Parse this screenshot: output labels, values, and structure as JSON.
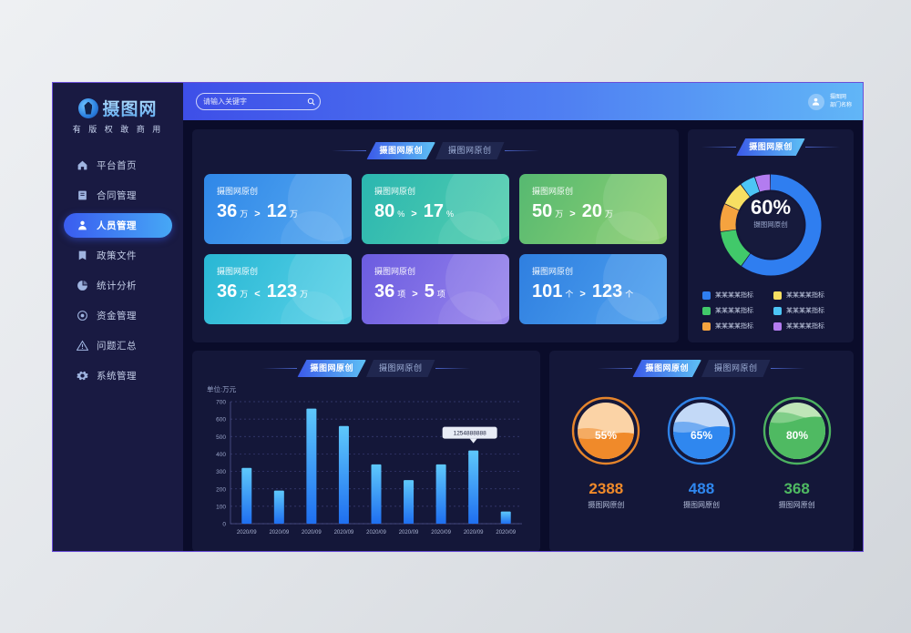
{
  "brand": {
    "name": "摄图网",
    "slogan": "有 版 权  敢 商 用",
    "logo_icon": "camera-shutter-icon"
  },
  "sidebar": {
    "items": [
      {
        "label": "平台首页",
        "icon": "home-icon",
        "active": false
      },
      {
        "label": "合同管理",
        "icon": "document-icon",
        "active": false
      },
      {
        "label": "人员管理",
        "icon": "user-icon",
        "active": true
      },
      {
        "label": "政策文件",
        "icon": "book-icon",
        "active": false
      },
      {
        "label": "统计分析",
        "icon": "pie-chart-icon",
        "active": false
      },
      {
        "label": "资金管理",
        "icon": "coin-icon",
        "active": false
      },
      {
        "label": "问题汇总",
        "icon": "warning-triangle-icon",
        "active": false
      },
      {
        "label": "系统管理",
        "icon": "gear-icon",
        "active": false
      }
    ]
  },
  "header": {
    "search_placeholder": "请输入关键字",
    "search_value": "",
    "search_icon": "search-icon",
    "avatar_icon": "user-avatar-icon",
    "user_name": "摄图网",
    "user_dept": "部门名称"
  },
  "kpi_panel": {
    "tabs": [
      {
        "label": "摄图网原创",
        "active": true
      },
      {
        "label": "摄图网原创",
        "active": false
      }
    ],
    "cards": [
      {
        "title": "摄图网原创",
        "v1": "36",
        "u1": "万",
        "cmp": ">",
        "v2": "12",
        "u2": "万",
        "color": "c1"
      },
      {
        "title": "摄图网原创",
        "v1": "80",
        "u1": "%",
        "cmp": ">",
        "v2": "17",
        "u2": "%",
        "color": "c2"
      },
      {
        "title": "摄图网原创",
        "v1": "50",
        "u1": "万",
        "cmp": ">",
        "v2": "20",
        "u2": "万",
        "color": "c3"
      },
      {
        "title": "摄图网原创",
        "v1": "36",
        "u1": "万",
        "cmp": "<",
        "v2": "123",
        "u2": "万",
        "color": "c4"
      },
      {
        "title": "摄图网原创",
        "v1": "36",
        "u1": "项",
        "cmp": ">",
        "v2": "5",
        "u2": "项",
        "color": "c5"
      },
      {
        "title": "摄图网原创",
        "v1": "101",
        "u1": "个",
        "cmp": ">",
        "v2": "123",
        "u2": "个",
        "color": "c6"
      }
    ]
  },
  "donut_panel": {
    "tabs": [
      {
        "label": "摄图网原创",
        "active": true
      }
    ],
    "center_value": "60%",
    "center_label": "摄图网原创",
    "legend": [
      {
        "label": "某某某某指标",
        "color": "#2f7ef0"
      },
      {
        "label": "某某某某指标",
        "color": "#f7df62"
      },
      {
        "label": "某某某某指标",
        "color": "#41c96a"
      },
      {
        "label": "某某某某指标",
        "color": "#4cc5f5"
      },
      {
        "label": "某某某某指标",
        "color": "#f5a33f"
      },
      {
        "label": "某某某某指标",
        "color": "#b37cf0"
      }
    ]
  },
  "bar_panel": {
    "tabs": [
      {
        "label": "摄图网原创",
        "active": true
      },
      {
        "label": "摄图网原创",
        "active": false
      }
    ],
    "axis_unit": "单位:万元",
    "tooltip": "1254888888"
  },
  "gauge_panel": {
    "tabs": [
      {
        "label": "摄图网原创",
        "active": true
      },
      {
        "label": "摄图网原创",
        "active": false
      }
    ],
    "gauges": [
      {
        "percent": "55%",
        "value": 55,
        "number": "2388",
        "label": "摄图网原创",
        "color": "#f08a2a",
        "light": "#fbd3a6",
        "ring": "#f08a2a"
      },
      {
        "percent": "65%",
        "value": 65,
        "number": "488",
        "label": "摄图网原创",
        "color": "#2f87ef",
        "light": "#c3d9f7",
        "ring": "#2f87ef"
      },
      {
        "percent": "80%",
        "value": 80,
        "number": "368",
        "label": "摄图网原创",
        "color": "#4fba62",
        "light": "#bfe6b8",
        "ring": "#4fba62"
      }
    ]
  },
  "chart_data": {
    "type": "bar",
    "title": "摄图网原创",
    "xlabel": "",
    "ylabel": "单位:万元",
    "ylim": [
      0,
      700
    ],
    "yticks": [
      0,
      100,
      200,
      300,
      400,
      500,
      600,
      700
    ],
    "grid": true,
    "categories": [
      "2020/09",
      "2020/09",
      "2020/09",
      "2020/09",
      "2020/09",
      "2020/09",
      "2020/09",
      "2020/09",
      "2020/09"
    ],
    "values": [
      320,
      190,
      660,
      560,
      340,
      250,
      340,
      420,
      70
    ],
    "annotation": {
      "text": "1254888888",
      "index": 7
    },
    "bar_color_top": "#5ec8fb",
    "bar_color_bottom": "#1f6ff0"
  }
}
